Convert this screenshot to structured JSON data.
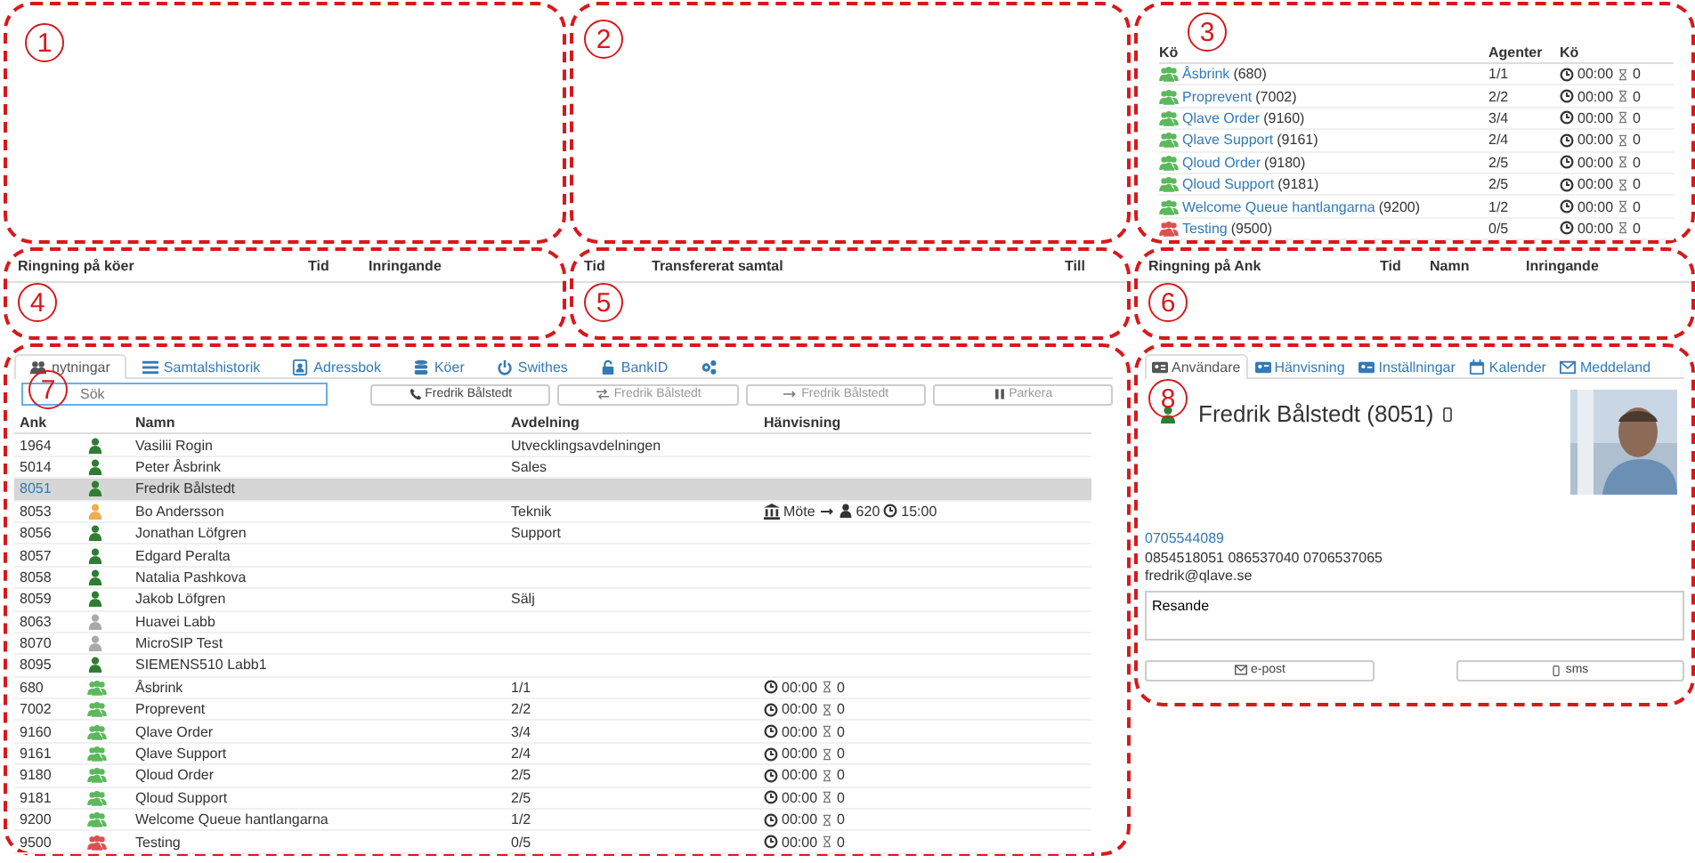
{
  "panels": [
    {
      "marker": "1"
    },
    {
      "marker": "2"
    }
  ],
  "queues": {
    "marker": "3",
    "columns": [
      "Kö",
      "Agenter",
      "Kö"
    ],
    "rows": [
      {
        "name": "Åsbrink",
        "number": "(680)",
        "agents": "1/1",
        "time": "00:00",
        "waiting": "0",
        "color": "#5cb85c"
      },
      {
        "name": "Proprevent",
        "number": "(7002)",
        "agents": "2/2",
        "time": "00:00",
        "waiting": "0",
        "color": "#5cb85c"
      },
      {
        "name": "Qlave Order",
        "number": "(9160)",
        "agents": "3/4",
        "time": "00:00",
        "waiting": "0",
        "color": "#5cb85c"
      },
      {
        "name": "Qlave Support",
        "number": "(9161)",
        "agents": "2/4",
        "time": "00:00",
        "waiting": "0",
        "color": "#5cb85c"
      },
      {
        "name": "Qloud Order",
        "number": "(9180)",
        "agents": "2/5",
        "time": "00:00",
        "waiting": "0",
        "color": "#5cb85c"
      },
      {
        "name": "Qloud Support",
        "number": "(9181)",
        "agents": "2/5",
        "time": "00:00",
        "waiting": "0",
        "color": "#5cb85c"
      },
      {
        "name": "Welcome Queue hantlangarna",
        "number": "(9200)",
        "agents": "1/2",
        "time": "00:00",
        "waiting": "0",
        "color": "#5cb85c"
      },
      {
        "name": "Testing",
        "number": "(9500)",
        "agents": "0/5",
        "time": "00:00",
        "waiting": "0",
        "color": "#d9534f"
      }
    ]
  },
  "ringing_queues": {
    "marker": "4",
    "columns": [
      "Ringning på köer",
      "Tid",
      "Inringande"
    ]
  },
  "transferred": {
    "marker": "5",
    "columns": [
      "Tid",
      "Transfererat samtal",
      "Till"
    ]
  },
  "ringing_ank": {
    "marker": "6",
    "columns": [
      "Ringning på Ank",
      "Tid",
      "Namn",
      "Inringande"
    ]
  },
  "extensions": {
    "marker": "7",
    "tabs": [
      {
        "kind": "text",
        "label": "nytningar",
        "selected": true
      },
      {
        "kind": "text",
        "label": "Samtalshistorik",
        "selected": false
      },
      {
        "kind": "text",
        "label": "Adressbok",
        "selected": false
      },
      {
        "kind": "text",
        "label": "Köer",
        "selected": false
      },
      {
        "kind": "text",
        "label": "Swithes",
        "selected": false
      },
      {
        "kind": "text",
        "label": "BankID",
        "selected": false
      },
      {
        "kind": "icon",
        "selected": false
      }
    ],
    "search": {
      "placeholder": "Sök"
    },
    "actions": [
      {
        "label": "Fredrik Bålstedt"
      },
      {
        "label": "Fredrik Bålstedt"
      },
      {
        "label": "Fredrik Bålstedt"
      },
      {
        "label": "Parkera"
      }
    ],
    "columns": [
      "Ank",
      "Namn",
      "Avdelning",
      "Hänvisning"
    ],
    "rows": [
      {
        "kind": "user",
        "ank": "1964",
        "color": "#2e7d32",
        "name": "Vasilii Rogin",
        "department": "Utvecklingsavdelningen",
        "selected": false
      },
      {
        "kind": "user",
        "ank": "5014",
        "color": "#2e7d32",
        "name": "Peter Åsbrink",
        "department": "Sales",
        "selected": false
      },
      {
        "kind": "user",
        "ank": "8051",
        "color": "#2e7d32",
        "name": "Fredrik Bålstedt",
        "selected": true
      },
      {
        "kind": "user",
        "ank": "8053",
        "color": "#f0ad4e",
        "name": "Bo Andersson",
        "department": "Teknik",
        "redirect": {
          "reason": "Möte",
          "to": "620",
          "until": "15:00"
        },
        "selected": false
      },
      {
        "kind": "user",
        "ank": "8056",
        "color": "#2e7d32",
        "name": "Jonathan Löfgren",
        "department": "Support",
        "selected": false
      },
      {
        "kind": "user",
        "ank": "8057",
        "color": "#2e7d32",
        "name": "Edgard Peralta",
        "selected": false
      },
      {
        "kind": "user",
        "ank": "8058",
        "color": "#2e7d32",
        "name": "Natalia Pashkova",
        "selected": false
      },
      {
        "kind": "user",
        "ank": "8059",
        "color": "#2e7d32",
        "name": "Jakob Löfgren",
        "department": "Sälj",
        "selected": false
      },
      {
        "kind": "user",
        "ank": "8063",
        "color": "#aaaaaa",
        "name": "Huavei Labb",
        "selected": false
      },
      {
        "kind": "user",
        "ank": "8070",
        "color": "#aaaaaa",
        "name": "MicroSIP Test",
        "selected": false
      },
      {
        "kind": "user",
        "ank": "8095",
        "color": "#2e7d32",
        "name": "SIEMENS510 Labb1",
        "selected": false
      },
      {
        "kind": "queue",
        "ank": "680",
        "color": "#5cb85c",
        "name": "Åsbrink",
        "department": "1/1",
        "time": "00:00",
        "waiting": "0",
        "selected": false
      },
      {
        "kind": "queue",
        "ank": "7002",
        "color": "#5cb85c",
        "name": "Proprevent",
        "department": "2/2",
        "time": "00:00",
        "waiting": "0",
        "selected": false
      },
      {
        "kind": "queue",
        "ank": "9160",
        "color": "#5cb85c",
        "name": "Qlave Order",
        "department": "3/4",
        "time": "00:00",
        "waiting": "0",
        "selected": false
      },
      {
        "kind": "queue",
        "ank": "9161",
        "color": "#5cb85c",
        "name": "Qlave Support",
        "department": "2/4",
        "time": "00:00",
        "waiting": "0",
        "selected": false
      },
      {
        "kind": "queue",
        "ank": "9180",
        "color": "#5cb85c",
        "name": "Qloud Order",
        "department": "2/5",
        "time": "00:00",
        "waiting": "0",
        "selected": false
      },
      {
        "kind": "queue",
        "ank": "9181",
        "color": "#5cb85c",
        "name": "Qloud Support",
        "department": "2/5",
        "time": "00:00",
        "waiting": "0",
        "selected": false
      },
      {
        "kind": "queue",
        "ank": "9200",
        "color": "#5cb85c",
        "name": "Welcome Queue hantlangarna",
        "department": "1/2",
        "time": "00:00",
        "waiting": "0",
        "selected": false
      },
      {
        "kind": "queue",
        "ank": "9500",
        "color": "#d9534f",
        "name": "Testing",
        "department": "0/5",
        "time": "00:00",
        "waiting": "0",
        "selected": false
      }
    ]
  },
  "user": {
    "marker": "8",
    "tabs": [
      {
        "label": "Användare",
        "selected": true
      },
      {
        "label": "Hänvisning",
        "selected": false
      },
      {
        "label": "Inställningar",
        "selected": false
      },
      {
        "label": "Kalender",
        "selected": false
      },
      {
        "label": "Meddeland",
        "selected": false
      }
    ],
    "name": "Fredrik Bålstedt (8051)",
    "color": "#2e7d32",
    "mobile": "0705544089",
    "phones": "0854518051 086537040 0706537065",
    "email": "fredrik@qlave.se",
    "note": "Resande",
    "buttons": [
      {
        "label": "e-post"
      },
      {
        "label": "sms"
      }
    ]
  }
}
